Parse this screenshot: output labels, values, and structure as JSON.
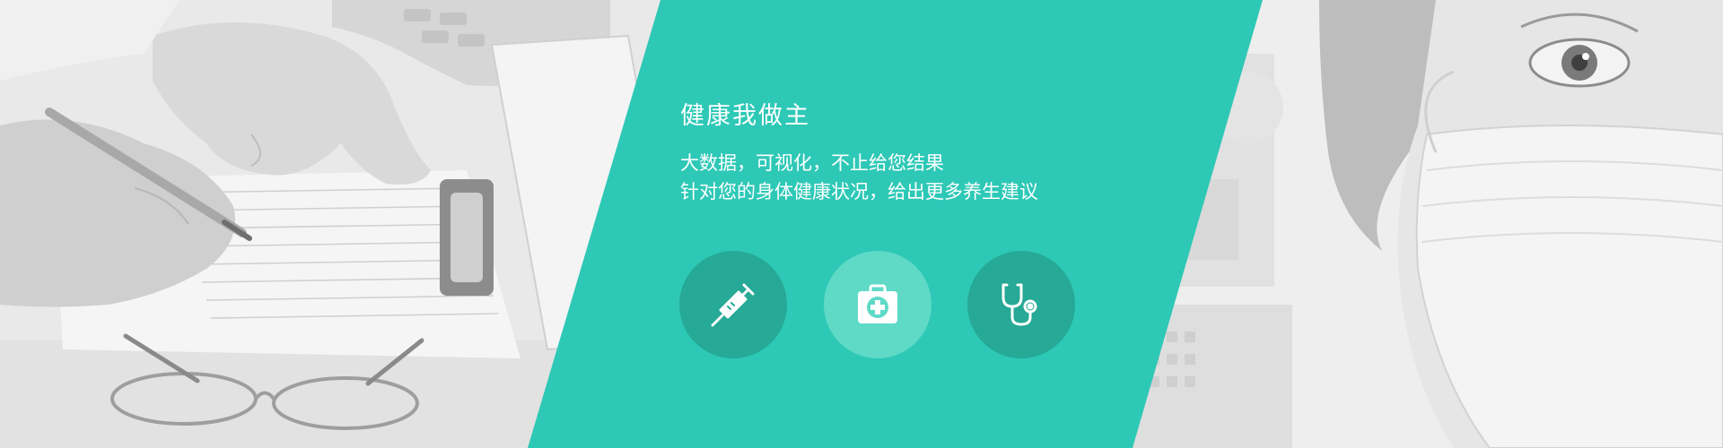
{
  "banner": {
    "title": "健康我做主",
    "lines": [
      "大数据，可视化，不止给您结果",
      "针对您的身体健康状况，给出更多养生建议"
    ],
    "colors": {
      "panel": "#2ec8b6",
      "icon_dark": "#26a996",
      "icon_light": "#5fdac7",
      "text": "#ffffff"
    },
    "icons": [
      {
        "name": "syringe-icon"
      },
      {
        "name": "first-aid-kit-icon"
      },
      {
        "name": "stethoscope-icon"
      }
    ]
  }
}
